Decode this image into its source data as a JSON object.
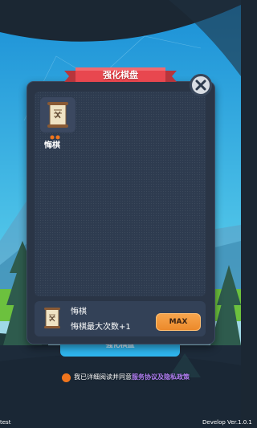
{
  "modal": {
    "title": "强化棋盘",
    "item": {
      "name": "悔棋",
      "level_dots": 2,
      "icon": "scroll-icon"
    },
    "footer": {
      "title": "悔棋",
      "description": "悔棋最大次数+1",
      "max_label": "MAX",
      "icon": "scroll-icon"
    },
    "close_icon": "close-icon"
  },
  "under_button": {
    "label": "强化棋盘"
  },
  "agreement": {
    "text": "我已详细阅读并同意",
    "link": "服务协议及隐私政策"
  },
  "corner": {
    "left": "test",
    "right": "Develop Ver.1.0.1"
  },
  "colors": {
    "panel": "#2a3546",
    "banner": "#e8474f",
    "accent_orange": "#ec8a2b",
    "sky_blue": "#2fb6ef",
    "link_purple": "#b07cf0"
  }
}
